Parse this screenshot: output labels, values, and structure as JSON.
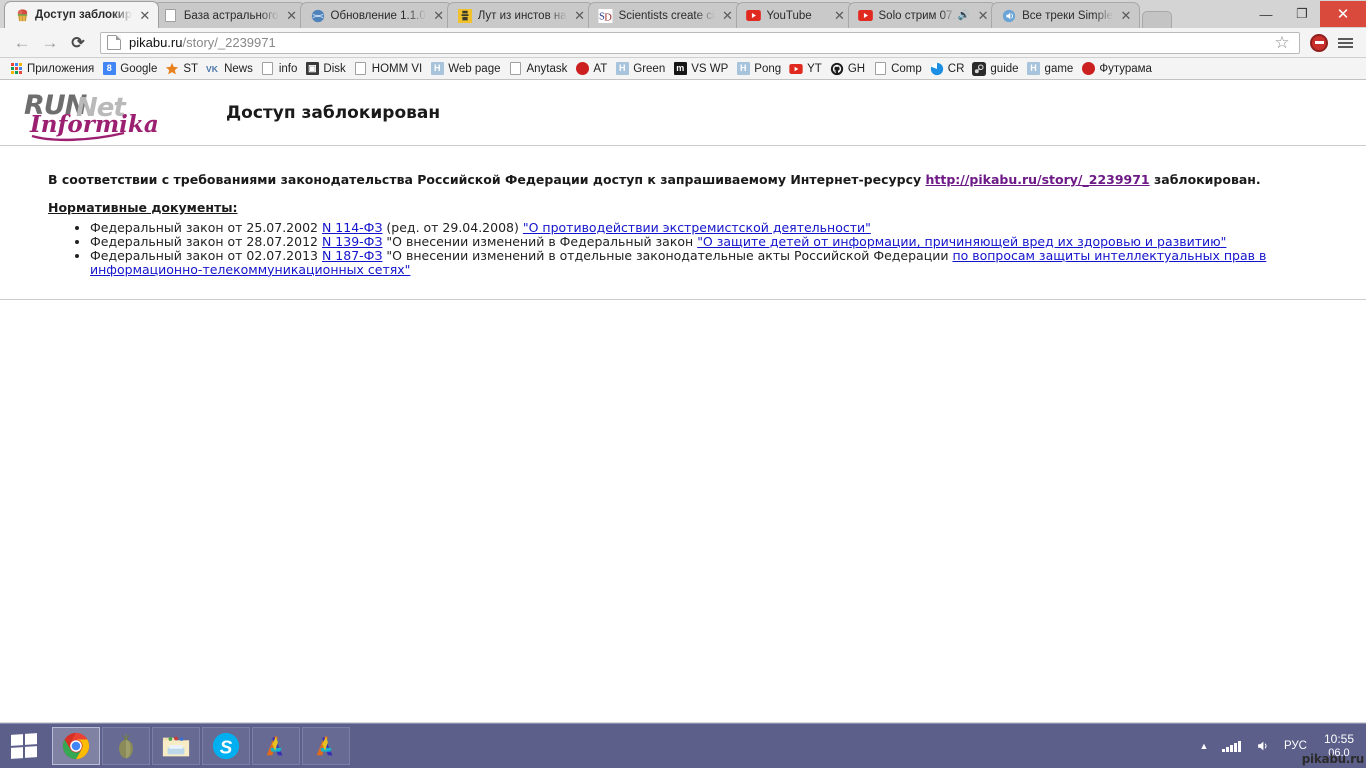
{
  "browser": {
    "tabs": [
      {
        "title": "Доступ заблокир",
        "favicon": "cupcake-icon",
        "active": true,
        "audio": false
      },
      {
        "title": "База астрального",
        "favicon": "page-icon",
        "active": false,
        "audio": false
      },
      {
        "title": "Обновление 1.1.0",
        "favicon": "globe-icon",
        "active": false,
        "audio": false
      },
      {
        "title": "Лут из инстов на",
        "favicon": "game-icon",
        "active": false,
        "audio": false
      },
      {
        "title": "Scientists create ci",
        "favicon": "sd-icon",
        "active": false,
        "audio": false
      },
      {
        "title": "YouTube",
        "favicon": "youtube-icon",
        "active": false,
        "audio": false
      },
      {
        "title": "Solo стрим 07.",
        "favicon": "youtube-icon",
        "active": false,
        "audio": true
      },
      {
        "title": "Все треки Simple",
        "favicon": "speaker-icon",
        "active": false,
        "audio": false
      }
    ],
    "tab_close_label": "✕",
    "window_controls": {
      "minimize": "—",
      "maximize": "❐",
      "close": "✕"
    },
    "toolbar": {
      "back_label": "←",
      "forward_label": "→",
      "reload_label": "⟳",
      "url_host": "pikabu.ru",
      "url_path": "/story/_2239971",
      "star_label": "☆"
    },
    "bookmarks": [
      {
        "label": "Приложения",
        "icon": "apps-grid-icon"
      },
      {
        "label": "Google",
        "icon": "google-icon"
      },
      {
        "label": "ST",
        "icon": "star-orange-icon"
      },
      {
        "label": "News",
        "icon": "vk-icon"
      },
      {
        "label": "info",
        "icon": "page-icon"
      },
      {
        "label": "Disk",
        "icon": "disk-icon"
      },
      {
        "label": "HOMM VI",
        "icon": "page-icon"
      },
      {
        "label": "Web page",
        "icon": "h-blue-icon"
      },
      {
        "label": "Anytask",
        "icon": "page-icon"
      },
      {
        "label": "AT",
        "icon": "red-ball-icon"
      },
      {
        "label": "Green",
        "icon": "h-blue-icon"
      },
      {
        "label": "VS WP",
        "icon": "m-black-icon"
      },
      {
        "label": "Pong",
        "icon": "h-blue-icon"
      },
      {
        "label": "YT",
        "icon": "youtube-icon"
      },
      {
        "label": "GH",
        "icon": "github-icon"
      },
      {
        "label": "Comp",
        "icon": "page-icon"
      },
      {
        "label": "CR",
        "icon": "cr-blue-icon"
      },
      {
        "label": "guide",
        "icon": "steam-icon"
      },
      {
        "label": "game",
        "icon": "h-blue-icon"
      },
      {
        "label": "Футурама",
        "icon": "red-ball-icon"
      }
    ]
  },
  "page": {
    "logo_alt": "RUNNet Informika",
    "logo_text_main": "RUNNet",
    "logo_text_sub": "Informika",
    "title": "Доступ заблокирован",
    "notice_before": "В соответствии с требованиями законодательства Российской Федерации доступ к запрашиваемому Интернет-ресурсу ",
    "notice_link": "http://pikabu.ru/story/_2239971",
    "notice_after": " заблокирован.",
    "docs_heading": "Нормативные документы:",
    "documents": [
      {
        "prefix": "Федеральный закон от 25.07.2002 ",
        "law_link": "N 114-ФЗ",
        "middle": " (ред. от 29.04.2008) ",
        "title_link": "\"О противодействии экстремистской деятельности\"",
        "suffix": ""
      },
      {
        "prefix": "Федеральный закон от 28.07.2012 ",
        "law_link": "N 139-ФЗ",
        "middle": " \"О внесении изменений в Федеральный закон ",
        "title_link": "\"О защите детей от информации, причиняющей вред их здоровью и развитию\"",
        "suffix": ""
      },
      {
        "prefix": "Федеральный закон от 02.07.2013 ",
        "law_link": "N 187-ФЗ",
        "middle": " \"О внесении изменений в отдельные законодательные акты Российской Федерации ",
        "title_link": "по вопросам защиты интеллектуальных прав в информационно-телекоммуникационных сетях\"",
        "suffix": ""
      }
    ],
    "colors": {
      "link_blue": "#1414cc",
      "link_visited_purple": "#6d1a87",
      "logo_magenta": "#9c2071",
      "logo_gray": "#7a7a7a"
    }
  },
  "taskbar": {
    "start_label": "Start",
    "tasks": [
      {
        "name": "chrome",
        "running": true
      },
      {
        "name": "tor-browser",
        "running": false
      },
      {
        "name": "file-explorer",
        "running": false
      },
      {
        "name": "skype",
        "running": false
      },
      {
        "name": "adobe-app-1",
        "running": false
      },
      {
        "name": "adobe-app-2",
        "running": false
      }
    ],
    "tray": {
      "show_hidden_label": "▲",
      "network_label": "network",
      "volume_label": "volume",
      "language": "РУС",
      "time": "10:55",
      "date": "06.0",
      "watermark": "pikabu.ru"
    }
  }
}
